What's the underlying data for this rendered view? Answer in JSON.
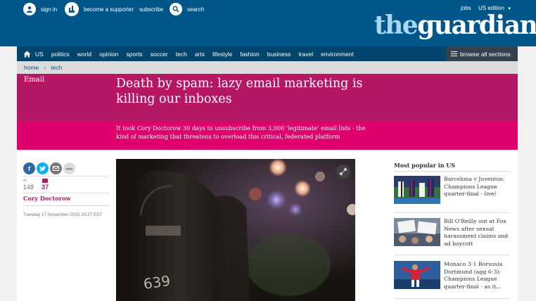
{
  "header": {
    "sign_in": "sign in",
    "supporter": "become a supporter",
    "subscribe": "subscribe",
    "search": "search",
    "jobs": "jobs",
    "edition": "US edition",
    "logo_the": "the",
    "logo_guardian": "guardian"
  },
  "nav": {
    "items": [
      "US",
      "politics",
      "world",
      "opinion",
      "sports",
      "soccer",
      "tech",
      "arts",
      "lifestyle",
      "fashion",
      "business",
      "travel",
      "environment"
    ],
    "browse_all": "browse all sections"
  },
  "breadcrumb": {
    "home": "home",
    "section": "tech"
  },
  "article": {
    "section_label": "Email",
    "headline": "Death by spam: lazy email marketing is killing our inboxes",
    "standfirst": "It took Cory Doctorow 30 days to unsubscribe from 3,000 'legitimate' email lists - the kind of marketing that threatens to overload this critical, federated platform",
    "share_count": "148",
    "comment_count": "37",
    "author": "Cory Doctorow",
    "date": "Tuesday 17 November 2015 10.27 EST"
  },
  "most_popular": {
    "title": "Most popular in US",
    "items": [
      {
        "text": "Barcelona v Juventus: Champions League quarter-final - live!"
      },
      {
        "text": "Bill O'Reilly out at Fox News after sexual harassment claims and ad boycott"
      },
      {
        "text": "Monaco 3-1 Borussia Dortmund (agg 6-3): Champions League quarter-final - as it..."
      }
    ]
  },
  "colors": {
    "brand_blue": "#005689",
    "nav_blue": "#00456e",
    "feature_dark": "#b51765",
    "feature_light": "#e0006d"
  }
}
